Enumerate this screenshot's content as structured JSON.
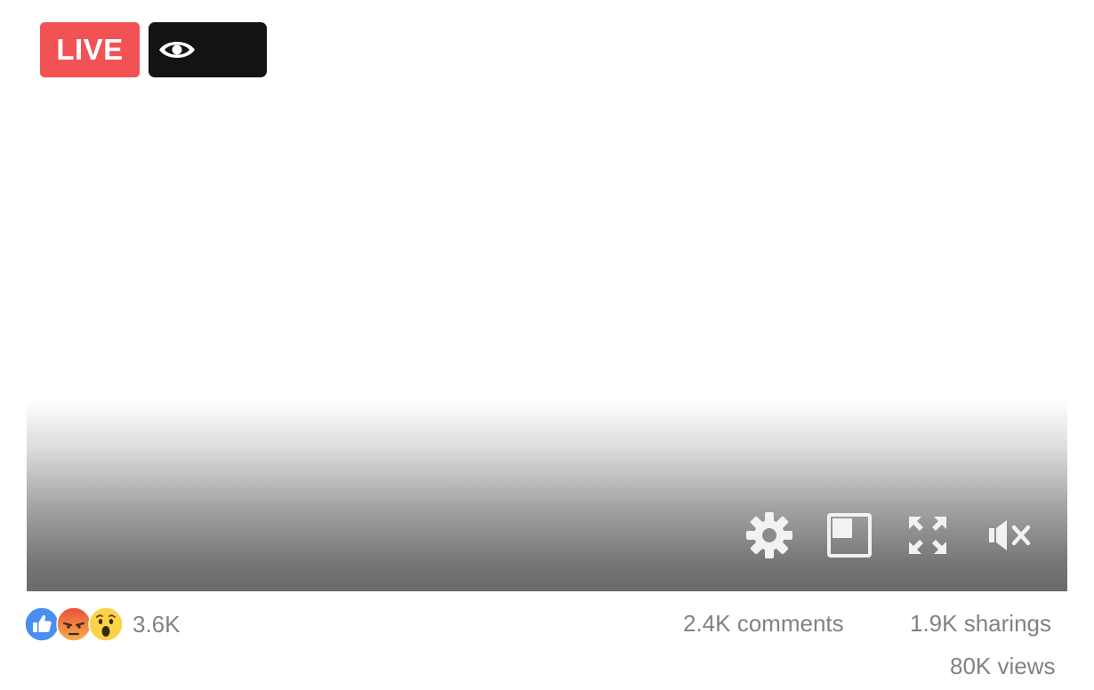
{
  "live_badge": {
    "label": "LIVE",
    "color": "#f25254"
  },
  "viewer_badge": {
    "icon": "eye-icon",
    "count": ""
  },
  "controls": [
    {
      "name": "settings",
      "icon": "gear-icon"
    },
    {
      "name": "picture-in-picture",
      "icon": "pip-icon"
    },
    {
      "name": "fullscreen",
      "icon": "expand-icon"
    },
    {
      "name": "mute",
      "icon": "speaker-muted-icon"
    }
  ],
  "reactions": {
    "icons": [
      "like-icon",
      "angry-icon",
      "wow-icon"
    ],
    "count": "3.6K"
  },
  "stats": {
    "comments": "2.4K comments",
    "sharings": "1.9K sharings",
    "views": "80K views"
  },
  "colors": {
    "like": "#4a8ef2",
    "angry": "#f07f3c",
    "wow": "#fbd34b",
    "stat_text": "#7f8388"
  }
}
